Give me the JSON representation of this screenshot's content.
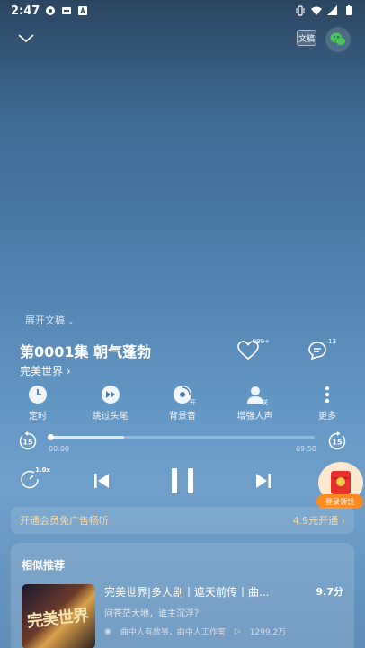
{
  "status_bar": {
    "time": "2:47"
  },
  "top_bar": {
    "doc_label": "文稿"
  },
  "expand_label": "展开文稿",
  "episode": {
    "title": "第0001集 朝气蓬勃",
    "album": "完美世界",
    "like_count": "999+",
    "comment_count": "13"
  },
  "funcs": [
    {
      "label": "定时",
      "icon": "clock-icon"
    },
    {
      "label": "跳过头尾",
      "icon": "skip-intro-icon"
    },
    {
      "label": "背景音",
      "icon": "background-sound-icon",
      "badge": "开"
    },
    {
      "label": "增强人声",
      "icon": "voice-enhance-icon",
      "badge": "关"
    },
    {
      "label": "更多",
      "icon": "more-vertical-icon"
    }
  ],
  "player": {
    "current_time": "00:00",
    "total_time": "09:58",
    "progress": 0.28,
    "skip_back_seconds": "15",
    "skip_forward_seconds": "15",
    "speed": "1.0x"
  },
  "promo": {
    "label": "登录领钱"
  },
  "vip": {
    "text": "开通会员免广告畅听",
    "price": "4.9元开通"
  },
  "recommend": {
    "title": "相似推荐",
    "item": {
      "name": "完美世界|多人剧丨遮天前传丨曲...",
      "score": "9.7分",
      "desc": "问苍茫大地，谁主沉浮？",
      "author": "曲中人有故事，曲中人工作室",
      "plays": "1299.2万",
      "cover_text": "完美世界"
    }
  }
}
